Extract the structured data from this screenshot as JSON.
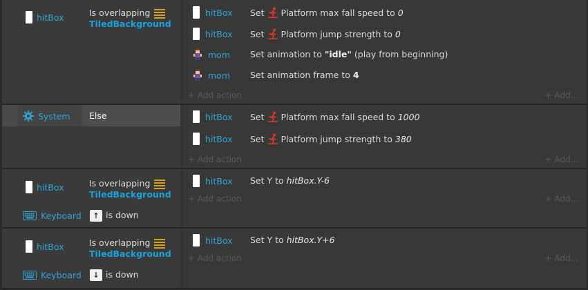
{
  "common": {
    "add_action": "+ Add action",
    "add_other": "+ Add..."
  },
  "events": [
    {
      "conditions": [
        {
          "object": "hitBox",
          "text": "Is overlapping",
          "target": "TiledBackground"
        }
      ],
      "actions": [
        {
          "object": "hitBox",
          "verb": "Set",
          "behavior": "Platform",
          "text": "max fall speed to",
          "value": "0"
        },
        {
          "object": "hitBox",
          "verb": "Set",
          "behavior": "Platform",
          "text": "jump strength to",
          "value": "0"
        },
        {
          "object": "mom",
          "verb": "Set animation to",
          "value": "\"idle\"",
          "suffix": "(play from beginning)"
        },
        {
          "object": "mom",
          "verb": "Set animation frame to",
          "value": "4"
        }
      ]
    },
    {
      "conditions": [
        {
          "object": "System",
          "text": "Else"
        }
      ],
      "actions": [
        {
          "object": "hitBox",
          "verb": "Set",
          "behavior": "Platform",
          "text": "max fall speed to",
          "value": "1000"
        },
        {
          "object": "hitBox",
          "verb": "Set",
          "behavior": "Platform",
          "text": "jump strength to",
          "value": "380"
        }
      ]
    },
    {
      "conditions": [
        {
          "object": "hitBox",
          "text": "Is overlapping",
          "target": "TiledBackground"
        },
        {
          "object": "Keyboard",
          "key": "↑",
          "text": "is down"
        }
      ],
      "actions": [
        {
          "object": "hitBox",
          "verb": "Set Y to",
          "value": "hitBox.Y-6"
        }
      ]
    },
    {
      "conditions": [
        {
          "object": "hitBox",
          "text": "Is overlapping",
          "target": "TiledBackground"
        },
        {
          "object": "Keyboard",
          "key": "↓",
          "text": "is down"
        }
      ],
      "actions": [
        {
          "object": "hitBox",
          "verb": "Set Y to",
          "value": "hitBox.Y+6"
        }
      ]
    }
  ]
}
